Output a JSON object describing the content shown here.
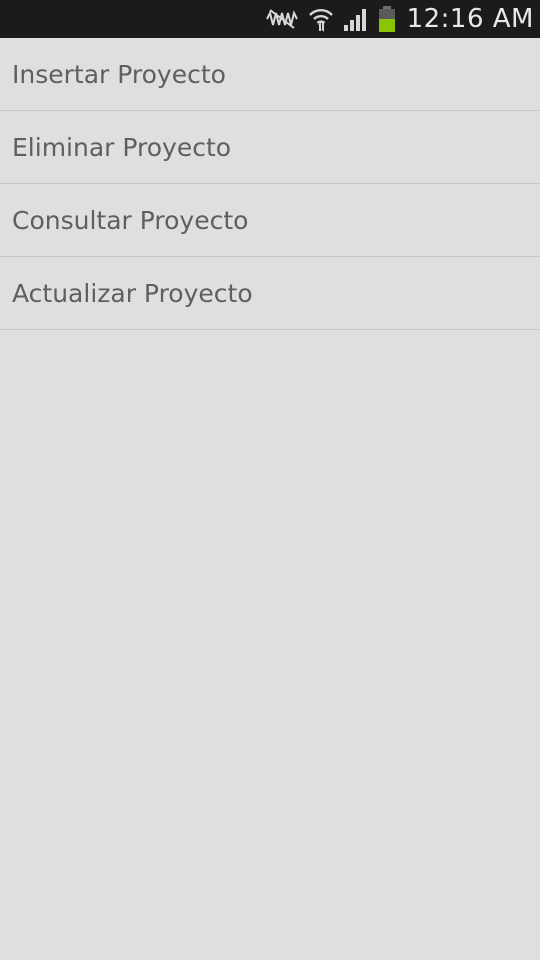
{
  "status_bar": {
    "time": "12:16 AM",
    "icons": [
      "no-sound-icon",
      "wifi-icon",
      "signal-icon",
      "battery-icon"
    ],
    "battery_color": "#8bc400"
  },
  "menu": {
    "items": [
      {
        "label": "Insertar Proyecto"
      },
      {
        "label": "Eliminar Proyecto"
      },
      {
        "label": "Consultar Proyecto"
      },
      {
        "label": "Actualizar Proyecto"
      }
    ]
  }
}
